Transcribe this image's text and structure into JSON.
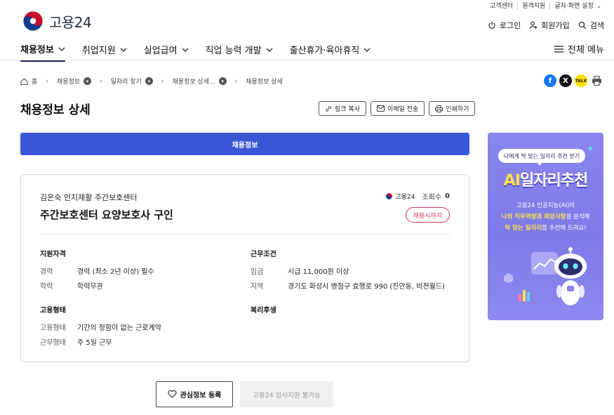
{
  "util_links": [
    "고객센터",
    "원격지원",
    "글자·화면 설정"
  ],
  "logo_text": "고용24",
  "account": {
    "login": "로그인",
    "signup": "회원가입",
    "search": "검색"
  },
  "gnb": [
    {
      "label": "채용정보"
    },
    {
      "label": "취업지원"
    },
    {
      "label": "실업급여"
    },
    {
      "label": "직업 능력 개발"
    },
    {
      "label": "출산휴가·육아휴직"
    }
  ],
  "all_menu": "전체 메뉴",
  "breadcrumb": [
    "홈",
    "채용정보",
    "일자리 찾기",
    "채용정보 상세...",
    "채용정보 상세"
  ],
  "page_title": "채용정보 상세",
  "tools": {
    "link_copy": "링크 복사",
    "email": "이메일 전송",
    "print": "인쇄하기"
  },
  "tab_label": "채용정보",
  "job": {
    "company": "김은숙 인지재활 주간보호센터",
    "title": "주간보호센터 요양보호사 구인",
    "views_label": "조회수",
    "views": "0",
    "deadline": "채용시까지",
    "source_logo": "고용24"
  },
  "qualification": {
    "title": "지원자격",
    "rows": [
      {
        "k": "경력",
        "v": "경력 (최소 2년 이상) 필수"
      },
      {
        "k": "학력",
        "v": "학력무관"
      }
    ]
  },
  "conditions": {
    "title": "근무조건",
    "rows": [
      {
        "k": "임금",
        "v": "시급 11,000원 이상"
      },
      {
        "k": "지역",
        "v": "경기도 화성시 병점구 효행로 990 (진안동, 비젼월드)"
      }
    ]
  },
  "employment": {
    "title": "고용형태",
    "rows": [
      {
        "k": "고용형태",
        "v": "기간의 정함이 없는 근로계약"
      },
      {
        "k": "근무형태",
        "v": "주 5일 근무"
      }
    ]
  },
  "welfare": {
    "title": "복리후생"
  },
  "actions": {
    "interest": "관심정보 등록",
    "apply": "고용24 입사지원 불가능"
  },
  "ad": {
    "pill": "나에게 딱 맞는 일자리 추천 받기",
    "headline_ai": "AI",
    "headline_rest": "일자리추천",
    "desc_line1": "고용24 인공지능(AI)이",
    "desc_line2_hl": "나의 직무역량과 희망사항",
    "desc_line2_rest": "을 분석해",
    "desc_line3_hl": "딱 맞는 일자리",
    "desc_line3_rest": "를 추천해 드려요!"
  },
  "colors": {
    "primary": "#3b56d6",
    "badge": "#d23a5a",
    "ad_bg": "#8a86ef",
    "ad_accent": "#ffe14d"
  }
}
